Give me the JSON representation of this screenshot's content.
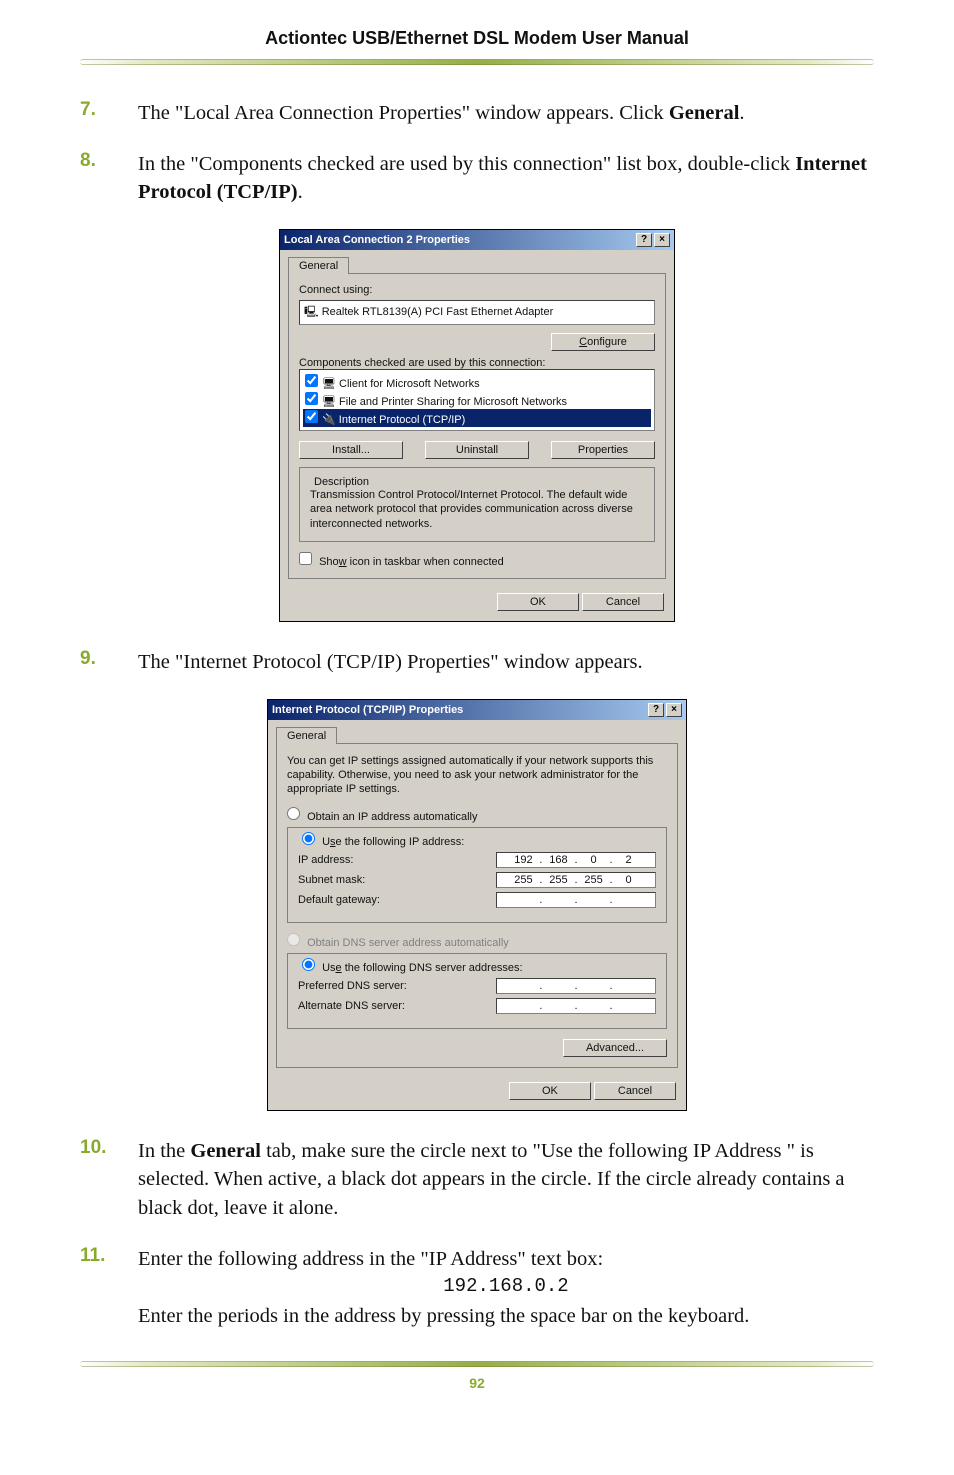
{
  "header": {
    "title": "Actiontec USB/Ethernet DSL Modem User Manual"
  },
  "steps": {
    "s7": {
      "num": "7.",
      "text_a": "The \"Local Area Connection Properties\" window appears. Click ",
      "bold": "General",
      "text_b": "."
    },
    "s8": {
      "num": "8.",
      "text_a": "In the \"Components checked are used by this connection\" list box, double-click ",
      "bold": "Internet Protocol (TCP/IP)",
      "text_b": "."
    },
    "s9": {
      "num": "9.",
      "text": "The \"Internet Protocol (TCP/IP) Properties\" window appears."
    },
    "s10": {
      "num": "10.",
      "text_a": "In the ",
      "bold": "General",
      "text_b": " tab, make sure the circle next to \"Use the following IP Address \" is selected. When active, a black dot appears in the circle. If the circle already contains a black dot, leave it alone."
    },
    "s11": {
      "num": "11.",
      "line1": "Enter the following address in the \"IP Address\" text box:",
      "ip": "192.168.0.2",
      "line2": "Enter the periods in the address by pressing the space bar on the keyboard."
    }
  },
  "dlg1": {
    "title": "Local Area Connection 2 Properties",
    "tab": "General",
    "connect_using_label": "Connect using:",
    "adapter": "Realtek RTL8139(A) PCI Fast Ethernet Adapter",
    "configure_btn": "Configure",
    "components_label": "Components checked are used by this connection:",
    "items": {
      "i1": "Client for Microsoft Networks",
      "i2": "File and Printer Sharing for Microsoft Networks",
      "i3": "Internet Protocol (TCP/IP)"
    },
    "install_btn": "Install...",
    "uninstall_btn": "Uninstall",
    "properties_btn": "Properties",
    "desc_label": "Description",
    "desc_text": "Transmission Control Protocol/Internet Protocol. The default wide area network protocol that provides communication across diverse interconnected networks.",
    "show_icon": "Show icon in taskbar when connected",
    "ok_btn": "OK",
    "cancel_btn": "Cancel"
  },
  "dlg2": {
    "title": "Internet Protocol (TCP/IP) Properties",
    "tab": "General",
    "intro": "You can get IP settings assigned automatically if your network supports this capability. Otherwise, you need to ask your network administrator for the appropriate IP settings.",
    "r_auto_ip": "Obtain an IP address automatically",
    "r_static_ip": "Use the following IP address:",
    "ip_label": "IP address:",
    "ip": {
      "a": "192",
      "b": "168",
      "c": "0",
      "d": "2"
    },
    "mask_label": "Subnet mask:",
    "mask": {
      "a": "255",
      "b": "255",
      "c": "255",
      "d": "0"
    },
    "gw_label": "Default gateway:",
    "r_auto_dns": "Obtain DNS server address automatically",
    "r_static_dns": "Use the following DNS server addresses:",
    "pref_dns_label": "Preferred DNS server:",
    "alt_dns_label": "Alternate DNS server:",
    "advanced_btn": "Advanced...",
    "ok_btn": "OK",
    "cancel_btn": "Cancel"
  },
  "footer": {
    "page": "92"
  }
}
